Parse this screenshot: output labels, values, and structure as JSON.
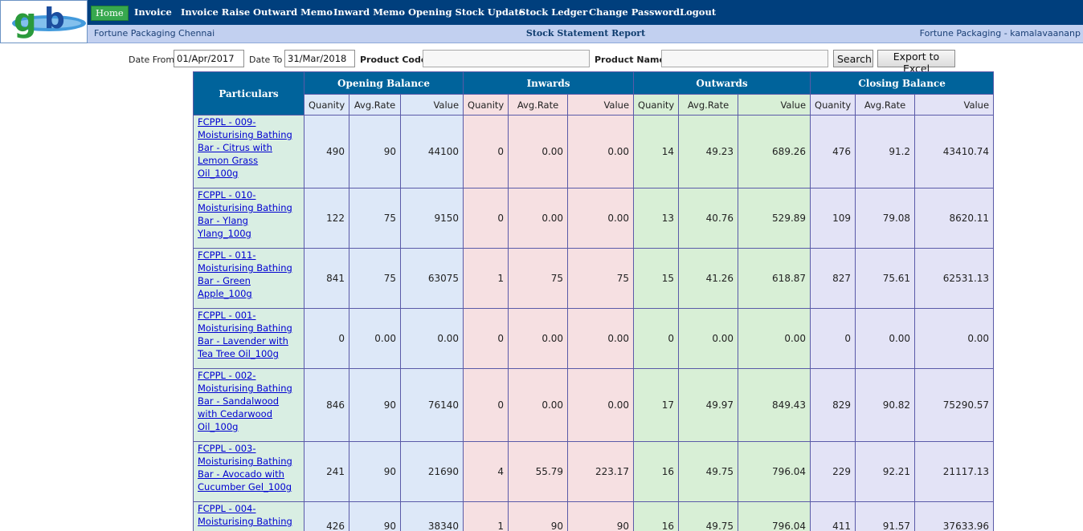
{
  "nav": {
    "items": [
      {
        "label": "Home",
        "active": true
      },
      {
        "label": "Invoice"
      },
      {
        "label": "Invoice Raise"
      },
      {
        "label": "Outward Memo"
      },
      {
        "label": "Inward Memo"
      },
      {
        "label": "Opening Stock Update"
      },
      {
        "label": "Stock Ledger"
      },
      {
        "label": "Change Password"
      },
      {
        "label": "Logout"
      }
    ]
  },
  "subbar": {
    "company": "Fortune Packaging Chennai",
    "report_title": "Stock Statement Report",
    "user": "Fortune Packaging - kamalavaananp"
  },
  "filters": {
    "date_from_label": "Date From",
    "date_from": "01/Apr/2017",
    "date_to_label": "Date To",
    "date_to": "31/Mar/2018",
    "product_code_label": "Product Code",
    "product_code": "",
    "product_name_label": "Product Name",
    "product_name": "",
    "search_label": "Search",
    "export_label": "Export to Excel"
  },
  "table": {
    "particulars_header": "Particulars",
    "groups": [
      "Opening Balance",
      "Inwards",
      "Outwards",
      "Closing Balance"
    ],
    "sub_headers": [
      "Quanity",
      "Avg.Rate",
      "Value"
    ],
    "rows": [
      {
        "name": "FCPPL - 009- Moisturising Bathing Bar - Citrus with Lemon Grass Oil_100g",
        "ob": [
          "490",
          "90",
          "44100"
        ],
        "in": [
          "0",
          "0.00",
          "0.00"
        ],
        "out": [
          "14",
          "49.23",
          "689.26"
        ],
        "cb": [
          "476",
          "91.2",
          "43410.74"
        ]
      },
      {
        "name": "FCPPL - 010- Moisturising Bathing Bar - Ylang Ylang_100g",
        "ob": [
          "122",
          "75",
          "9150"
        ],
        "in": [
          "0",
          "0.00",
          "0.00"
        ],
        "out": [
          "13",
          "40.76",
          "529.89"
        ],
        "cb": [
          "109",
          "79.08",
          "8620.11"
        ]
      },
      {
        "name": "FCPPL - 011- Moisturising Bathing Bar - Green Apple_100g",
        "ob": [
          "841",
          "75",
          "63075"
        ],
        "in": [
          "1",
          "75",
          "75"
        ],
        "out": [
          "15",
          "41.26",
          "618.87"
        ],
        "cb": [
          "827",
          "75.61",
          "62531.13"
        ]
      },
      {
        "name": "FCPPL - 001- Moisturising Bathing Bar - Lavender with Tea Tree Oil_100g",
        "ob": [
          "0",
          "0.00",
          "0.00"
        ],
        "in": [
          "0",
          "0.00",
          "0.00"
        ],
        "out": [
          "0",
          "0.00",
          "0.00"
        ],
        "cb": [
          "0",
          "0.00",
          "0.00"
        ]
      },
      {
        "name": "FCPPL - 002- Moisturising Bathing Bar - Sandalwood with Cedarwood Oil_100g",
        "ob": [
          "846",
          "90",
          "76140"
        ],
        "in": [
          "0",
          "0.00",
          "0.00"
        ],
        "out": [
          "17",
          "49.97",
          "849.43"
        ],
        "cb": [
          "829",
          "90.82",
          "75290.57"
        ]
      },
      {
        "name": "FCPPL - 003- Moisturising Bathing Bar - Avocado with Cucumber Gel_100g",
        "ob": [
          "241",
          "90",
          "21690"
        ],
        "in": [
          "4",
          "55.79",
          "223.17"
        ],
        "out": [
          "16",
          "49.75",
          "796.04"
        ],
        "cb": [
          "229",
          "92.21",
          "21117.13"
        ]
      },
      {
        "name": "FCPPL - 004- Moisturising Bathing",
        "ob": [
          "426",
          "90",
          "38340"
        ],
        "in": [
          "1",
          "90",
          "90"
        ],
        "out": [
          "16",
          "49.75",
          "796.04"
        ],
        "cb": [
          "411",
          "91.57",
          "37633.96"
        ]
      }
    ]
  }
}
